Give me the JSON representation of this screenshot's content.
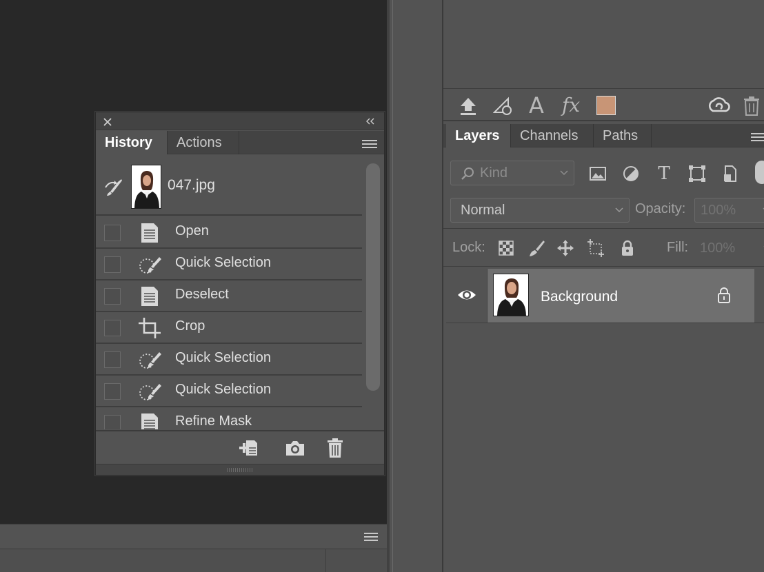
{
  "history_panel": {
    "tabs": [
      "History",
      "Actions"
    ],
    "snapshot_name": "047.jpg",
    "items": [
      {
        "label": "Open",
        "icon": "document-icon"
      },
      {
        "label": "Quick Selection",
        "icon": "quick-selection-icon"
      },
      {
        "label": "Deselect",
        "icon": "document-icon"
      },
      {
        "label": "Crop",
        "icon": "crop-icon"
      },
      {
        "label": "Quick Selection",
        "icon": "quick-selection-icon"
      },
      {
        "label": "Quick Selection",
        "icon": "quick-selection-icon"
      },
      {
        "label": "Refine Mask",
        "icon": "document-icon"
      }
    ]
  },
  "layers_panel": {
    "toolbar": {
      "text_glyph": "A",
      "fx_glyph": "fx",
      "swatch_color": "#c89576"
    },
    "tabs": [
      "Layers",
      "Channels",
      "Paths"
    ],
    "filter": {
      "placeholder": "Kind",
      "type_glyph": "T"
    },
    "blend_mode": "Normal",
    "opacity_label": "Opacity:",
    "opacity_value": "100%",
    "lock_label": "Lock:",
    "fill_label": "Fill:",
    "fill_value": "100%",
    "layers": [
      {
        "name": "Background",
        "visible": true,
        "locked": true
      }
    ]
  },
  "colors": {
    "panel_bg": "#535353",
    "canvas_bg": "#282828",
    "selected_layer": "#6f6f6f"
  }
}
